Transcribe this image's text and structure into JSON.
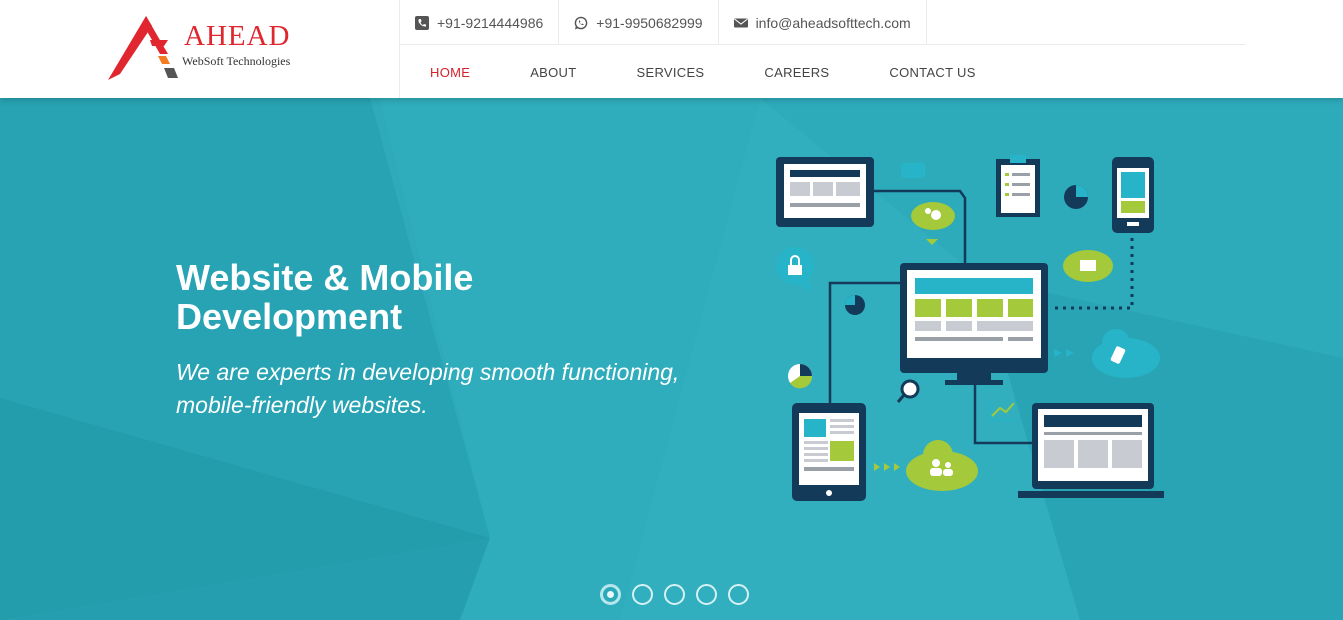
{
  "brand": {
    "name": "AHEAD",
    "tagline": "WebSoft Technologies",
    "accent_color": "#e0262f"
  },
  "contact": {
    "phone": {
      "icon": "phone-icon",
      "text": "+91-9214444986"
    },
    "whatsapp": {
      "icon": "whatsapp-icon",
      "text": "+91-9950682999"
    },
    "email": {
      "icon": "envelope-icon",
      "text": "info@aheadsofttech.com"
    }
  },
  "nav": {
    "items": [
      {
        "label": "HOME",
        "active": true
      },
      {
        "label": "ABOUT",
        "active": false
      },
      {
        "label": "SERVICES",
        "active": false
      },
      {
        "label": "CAREERS",
        "active": false
      },
      {
        "label": "CONTACT US",
        "active": false
      }
    ],
    "active_color": "#d3212d"
  },
  "hero": {
    "title": "Website & Mobile Development",
    "subtitle": "We are experts in developing smooth functioning, mobile-friendly websites.",
    "background_color": "#2aa9b9",
    "slider": {
      "total": 5,
      "active": 1
    }
  }
}
